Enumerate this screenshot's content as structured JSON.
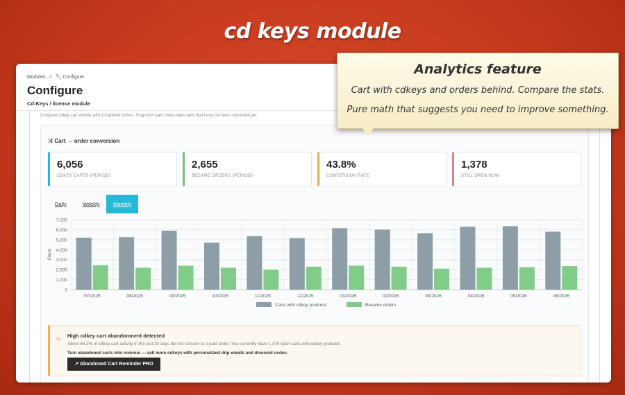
{
  "banner": {
    "title": "cd keys module"
  },
  "callout": {
    "title": "Analytics feature",
    "line1": "Cart with cdkeys and orders behind. Compare the stats.",
    "line2": "Pure math that suggests you need to improve something."
  },
  "breadcrumb": {
    "modules": "Modules",
    "sep": ">",
    "configure_icon": "wrench-icon",
    "configure": "Configure"
  },
  "header": {
    "title": "Configure",
    "subtitle": "Cd-Keys / license module"
  },
  "description": "Compare cdkey cart activity with completed orders. Snapshot stats show open carts that have not been converted yet.",
  "panel": {
    "icon": "shuffle-icon",
    "title": "Cart → order conversion"
  },
  "kpis": [
    {
      "value": "6,056",
      "label": "CDKEY CARTS (PERIOD)",
      "color": "#25b9d7"
    },
    {
      "value": "2,655",
      "label": "BECAME ORDERS (PERIOD)",
      "color": "#72c279"
    },
    {
      "value": "43.8%",
      "label": "CONVERSION RATE",
      "color": "#f0ad4e"
    },
    {
      "value": "1,378",
      "label": "STILL OPEN NOW",
      "color": "#e08283"
    }
  ],
  "tabs": [
    {
      "label": "Daily",
      "active": false
    },
    {
      "label": "Weekly",
      "active": false
    },
    {
      "label": "Monthly",
      "active": true
    }
  ],
  "chart_data": {
    "type": "bar",
    "categories": [
      "07/2025",
      "08/2025",
      "09/2025",
      "10/2025",
      "11/2025",
      "12/2025",
      "01/2026",
      "02/2026",
      "03/2026",
      "04/2026",
      "05/2026",
      "06/2026"
    ],
    "series": [
      {
        "name": "Carts with cdkey products",
        "color": "#8d9ea6",
        "values": [
          5200,
          5250,
          5900,
          4700,
          5350,
          5150,
          6150,
          6000,
          5650,
          6300,
          6350,
          5800
        ]
      },
      {
        "name": "Became orders",
        "color": "#80cc88",
        "values": [
          2450,
          2200,
          2400,
          2200,
          2000,
          2300,
          2400,
          2300,
          2100,
          2200,
          2250,
          2350
        ]
      }
    ],
    "ylabel": "Count",
    "ylim": [
      0,
      7000
    ],
    "yticks": [
      "0",
      "1,000",
      "2,000",
      "3,000",
      "4,000",
      "5,000",
      "6,000",
      "7,000"
    ],
    "grid": true,
    "legend": "bottom-center"
  },
  "alert": {
    "icon": "envelope-icon",
    "title": "High cdkey cart abandonment detected",
    "body": "About 56.2% of cdkey cart activity in the last 30 days did not convert to a paid order. You currently have 1,378 open carts with cdkey products.",
    "cta": "Turn abandoned carts into revenue — sell more cdkeys with personalized drip emails and discount codes.",
    "button_icon": "external-link-icon",
    "button": "Abandoned Cart Reminder PRO"
  }
}
